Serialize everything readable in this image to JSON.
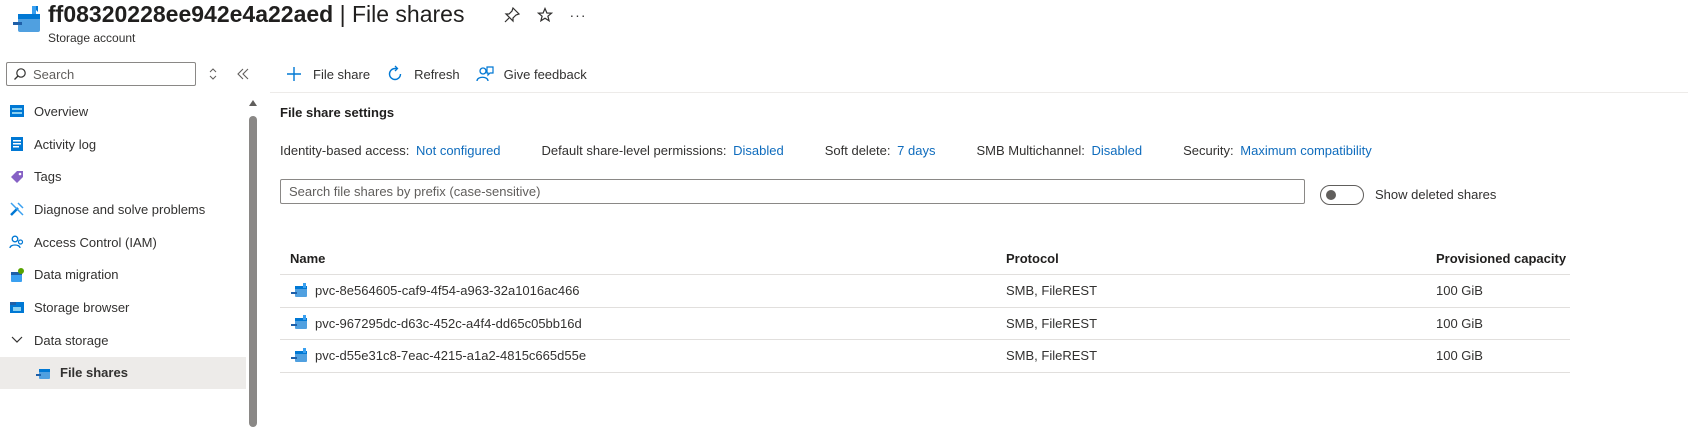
{
  "header": {
    "resource_name": "ff08320228ee942e4a22aed",
    "separator": " | ",
    "page_name": "File shares",
    "subtitle": "Storage account",
    "more_label": "···"
  },
  "sidebar": {
    "search_placeholder": "Search",
    "items": [
      {
        "label": "Overview",
        "icon": "overview-icon"
      },
      {
        "label": "Activity log",
        "icon": "activity-log-icon"
      },
      {
        "label": "Tags",
        "icon": "tag-icon"
      },
      {
        "label": "Diagnose and solve problems",
        "icon": "wrench-icon"
      },
      {
        "label": "Access Control (IAM)",
        "icon": "people-icon"
      },
      {
        "label": "Data migration",
        "icon": "data-migration-icon"
      },
      {
        "label": "Storage browser",
        "icon": "storage-browser-icon"
      },
      {
        "label": "Data storage",
        "icon": "chevron-down-icon"
      },
      {
        "label": "File shares",
        "icon": "file-share-icon",
        "selected": true
      }
    ]
  },
  "toolbar": {
    "add_label": "File share",
    "refresh_label": "Refresh",
    "feedback_label": "Give feedback"
  },
  "settings": {
    "title": "File share settings",
    "identity_label": "Identity-based access:",
    "identity_value": "Not configured",
    "permissions_label": "Default share-level permissions:",
    "permissions_value": "Disabled",
    "soft_delete_label": "Soft delete:",
    "soft_delete_value": "7 days",
    "smb_label": "SMB Multichannel:",
    "smb_value": "Disabled",
    "security_label": "Security:",
    "security_value": "Maximum compatibility"
  },
  "filter": {
    "placeholder": "Search file shares by prefix (case-sensitive)",
    "toggle_label": "Show deleted shares",
    "toggle_on": false
  },
  "table": {
    "headers": [
      "Name",
      "Protocol",
      "Provisioned capacity"
    ],
    "rows": [
      {
        "name": "pvc-8e564605-caf9-4f54-a963-32a1016ac466",
        "protocol": "SMB, FileREST",
        "capacity": "100 GiB"
      },
      {
        "name": "pvc-967295dc-d63c-452c-a4f4-dd65c05bb16d",
        "protocol": "SMB, FileREST",
        "capacity": "100 GiB"
      },
      {
        "name": "pvc-d55e31c8-7eac-4215-a1a2-4815c665d55e",
        "protocol": "SMB, FileREST",
        "capacity": "100 GiB"
      }
    ]
  },
  "colors": {
    "link": "#0f6cbd",
    "accent": "#0078d4",
    "selected_bg": "#edebe9"
  }
}
